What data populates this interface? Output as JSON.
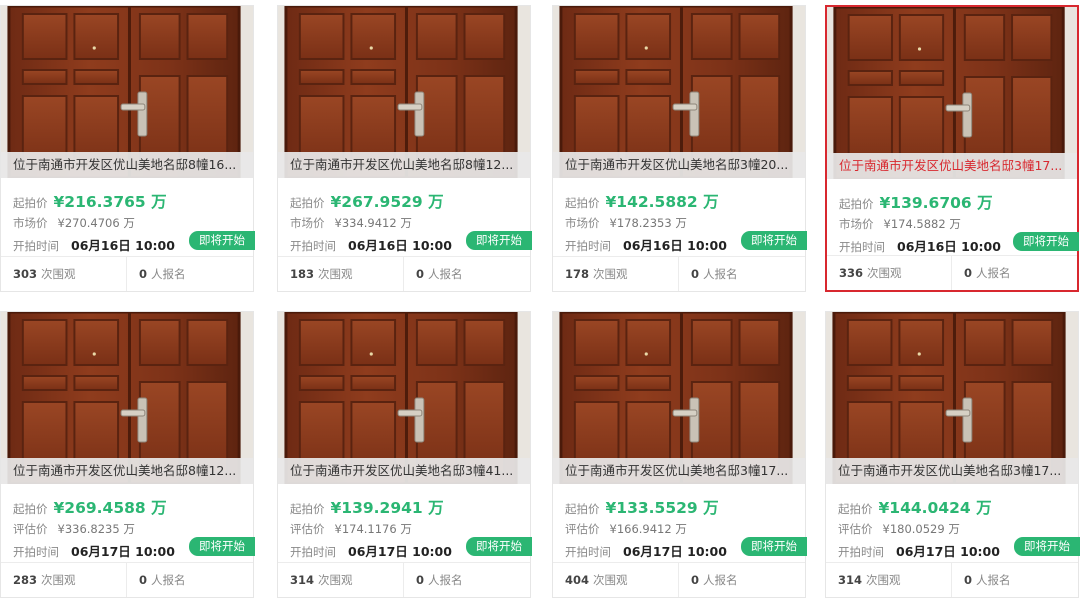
{
  "accent_color": "#2bb673",
  "selected_border_color": "#d8282f",
  "labels": {
    "start_price": "起拍价",
    "market_price": "市场价",
    "assessed_price": "评估价",
    "start_time": "开拍时间",
    "status": "即将开始",
    "views_suffix": "次围观",
    "registered_suffix": "人报名"
  },
  "cards": [
    {
      "title": "位于南通市开发区优山美地名邸8幢16...",
      "start_price": "¥216.3765 万",
      "ref_price": "¥270.4706 万",
      "time": "06月16日 10:00",
      "views": "303",
      "registered": "0",
      "selected": false
    },
    {
      "title": "位于南通市开发区优山美地名邸8幢12...",
      "start_price": "¥267.9529 万",
      "ref_price": "¥334.9412 万",
      "time": "06月16日 10:00",
      "views": "183",
      "registered": "0",
      "selected": false
    },
    {
      "title": "位于南通市开发区优山美地名邸3幢20...",
      "start_price": "¥142.5882 万",
      "ref_price": "¥178.2353 万",
      "time": "06月16日 10:00",
      "views": "178",
      "registered": "0",
      "selected": false
    },
    {
      "title": "位于南通市开发区优山美地名邸3幢17...",
      "start_price": "¥139.6706 万",
      "ref_price": "¥174.5882 万",
      "time": "06月16日 10:00",
      "views": "336",
      "registered": "0",
      "selected": true
    },
    {
      "title": "位于南通市开发区优山美地名邸8幢12...",
      "start_price": "¥269.4588 万",
      "ref_price": "¥336.8235 万",
      "time": "06月17日 10:00",
      "views": "283",
      "registered": "0",
      "selected": false
    },
    {
      "title": "位于南通市开发区优山美地名邸3幢41...",
      "start_price": "¥139.2941 万",
      "ref_price": "¥174.1176 万",
      "time": "06月17日 10:00",
      "views": "314",
      "registered": "0",
      "selected": false
    },
    {
      "title": "位于南通市开发区优山美地名邸3幢17...",
      "start_price": "¥133.5529 万",
      "ref_price": "¥166.9412 万",
      "time": "06月17日 10:00",
      "views": "404",
      "registered": "0",
      "selected": false
    },
    {
      "title": "位于南通市开发区优山美地名邸3幢17...",
      "start_price": "¥144.0424 万",
      "ref_price": "¥180.0529 万",
      "time": "06月17日 10:00",
      "views": "314",
      "registered": "0",
      "selected": false
    }
  ]
}
